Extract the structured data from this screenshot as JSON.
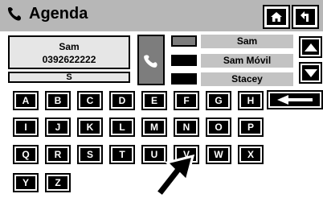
{
  "header": {
    "title": "Agenda",
    "home_icon": "home-icon",
    "back_icon": "back-arrow-icon"
  },
  "selected_contact": {
    "name": "Sam",
    "number": "0392622222",
    "current_letter": "S"
  },
  "results": [
    {
      "label": "Sam"
    },
    {
      "label": "Sam Móvil"
    },
    {
      "label": "Stacey"
    }
  ],
  "keyboard": {
    "rows": [
      [
        "A",
        "B",
        "C",
        "D",
        "E",
        "F",
        "G",
        "H"
      ],
      [
        "I",
        "J",
        "K",
        "L",
        "M",
        "N",
        "O",
        "P"
      ],
      [
        "Q",
        "R",
        "S",
        "T",
        "U",
        "V",
        "W",
        "X"
      ],
      [
        "Y",
        "Z"
      ]
    ],
    "backspace_icon": "backspace-arrow-icon"
  },
  "colors": {
    "title_bar": "#b7b7b7",
    "field_bg": "#e6e6e6",
    "result_bg": "#c3c3c3",
    "key_bg": "#000000"
  }
}
